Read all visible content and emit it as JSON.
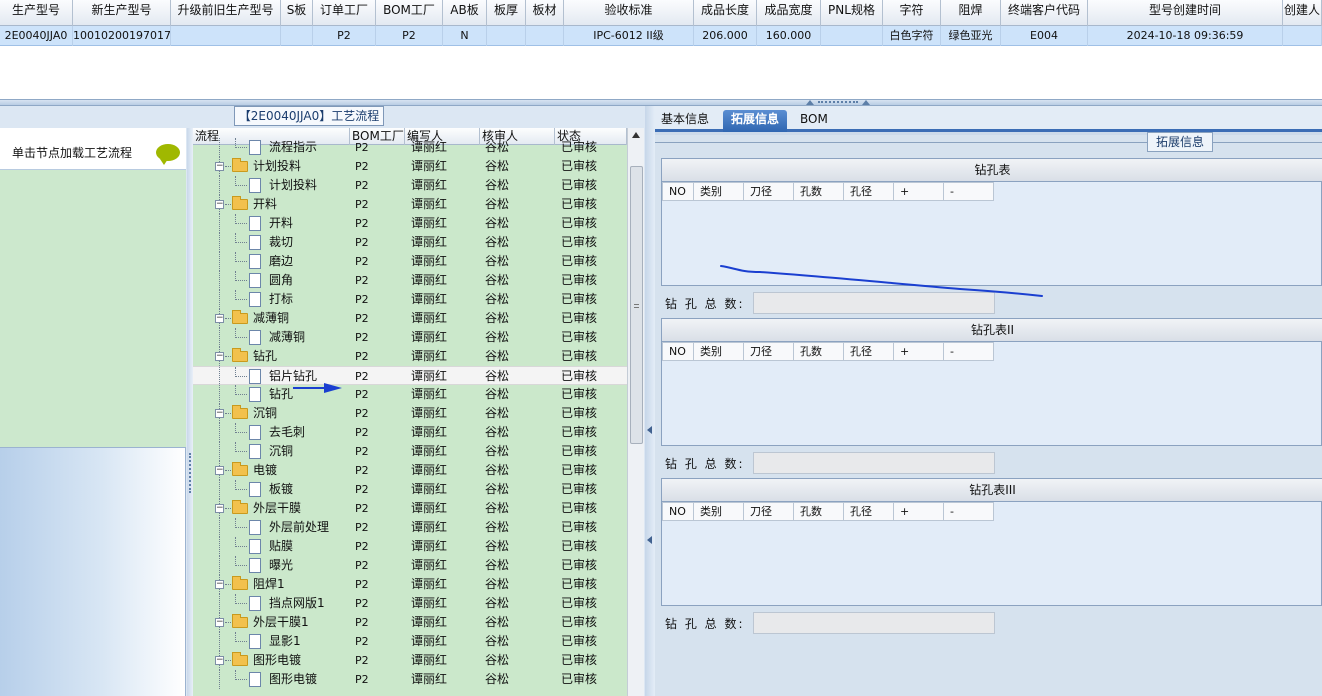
{
  "top_table": {
    "columns": [
      {
        "label": "生产型号",
        "w": 73
      },
      {
        "label": "新生产型号",
        "w": 98
      },
      {
        "label": "升级前旧生产型号",
        "w": 110
      },
      {
        "label": "S板",
        "w": 32
      },
      {
        "label": "订单工厂",
        "w": 63
      },
      {
        "label": "BOM工厂",
        "w": 67
      },
      {
        "label": "AB板",
        "w": 44
      },
      {
        "label": "板厚",
        "w": 39
      },
      {
        "label": "板材",
        "w": 38
      },
      {
        "label": "验收标准",
        "w": 130
      },
      {
        "label": "成品长度",
        "w": 63
      },
      {
        "label": "成品宽度",
        "w": 64
      },
      {
        "label": "PNL规格",
        "w": 62
      },
      {
        "label": "字符",
        "w": 58
      },
      {
        "label": "阻焊",
        "w": 60
      },
      {
        "label": "终端客户代码",
        "w": 87
      },
      {
        "label": "型号创建时间",
        "w": 195
      },
      {
        "label": "创建人",
        "w": 39
      }
    ],
    "row": [
      "2E0040JJA0",
      "10010200197017",
      "",
      "",
      "P2",
      "P2",
      "N",
      "",
      "",
      "IPC-6012 II级",
      "206.000",
      "160.000",
      "",
      "白色字符",
      "绿色亚光",
      "E004",
      "2024-10-18 09:36:59",
      ""
    ]
  },
  "process_title": "【2E0040JJA0】工艺流程",
  "left_panel": {
    "load_text": "单击节点加载工艺流程"
  },
  "tree_columns": [
    "流程",
    "BOM工厂",
    "编写人",
    "核审人",
    "状态"
  ],
  "tree_rows": [
    {
      "lvl": 1,
      "name": "流程指示",
      "bom": "P2",
      "writer": "谭丽红",
      "checker": "谷松",
      "status": "已审核"
    },
    {
      "lvl": 0,
      "name": "计划投料",
      "bom": "P2",
      "writer": "谭丽红",
      "checker": "谷松",
      "status": "已审核"
    },
    {
      "lvl": 1,
      "name": "计划投料",
      "bom": "P2",
      "writer": "谭丽红",
      "checker": "谷松",
      "status": "已审核"
    },
    {
      "lvl": 0,
      "name": "开料",
      "bom": "P2",
      "writer": "谭丽红",
      "checker": "谷松",
      "status": "已审核"
    },
    {
      "lvl": 1,
      "name": "开料",
      "bom": "P2",
      "writer": "谭丽红",
      "checker": "谷松",
      "status": "已审核"
    },
    {
      "lvl": 1,
      "name": "裁切",
      "bom": "P2",
      "writer": "谭丽红",
      "checker": "谷松",
      "status": "已审核"
    },
    {
      "lvl": 1,
      "name": "磨边",
      "bom": "P2",
      "writer": "谭丽红",
      "checker": "谷松",
      "status": "已审核"
    },
    {
      "lvl": 1,
      "name": "圆角",
      "bom": "P2",
      "writer": "谭丽红",
      "checker": "谷松",
      "status": "已审核"
    },
    {
      "lvl": 1,
      "name": "打标",
      "bom": "P2",
      "writer": "谭丽红",
      "checker": "谷松",
      "status": "已审核"
    },
    {
      "lvl": 0,
      "name": "减薄铜",
      "bom": "P2",
      "writer": "谭丽红",
      "checker": "谷松",
      "status": "已审核"
    },
    {
      "lvl": 1,
      "name": "减薄铜",
      "bom": "P2",
      "writer": "谭丽红",
      "checker": "谷松",
      "status": "已审核"
    },
    {
      "lvl": 0,
      "name": "钻孔",
      "bom": "P2",
      "writer": "谭丽红",
      "checker": "谷松",
      "status": "已审核"
    },
    {
      "lvl": 1,
      "name": "铝片钻孔",
      "bom": "P2",
      "writer": "谭丽红",
      "checker": "谷松",
      "status": "已审核",
      "selected": true
    },
    {
      "lvl": 1,
      "name": "钻孔",
      "bom": "P2",
      "writer": "谭丽红",
      "checker": "谷松",
      "status": "已审核"
    },
    {
      "lvl": 0,
      "name": "沉铜",
      "bom": "P2",
      "writer": "谭丽红",
      "checker": "谷松",
      "status": "已审核"
    },
    {
      "lvl": 1,
      "name": "去毛刺",
      "bom": "P2",
      "writer": "谭丽红",
      "checker": "谷松",
      "status": "已审核"
    },
    {
      "lvl": 1,
      "name": "沉铜",
      "bom": "P2",
      "writer": "谭丽红",
      "checker": "谷松",
      "status": "已审核"
    },
    {
      "lvl": 0,
      "name": "电镀",
      "bom": "P2",
      "writer": "谭丽红",
      "checker": "谷松",
      "status": "已审核"
    },
    {
      "lvl": 1,
      "name": "板镀",
      "bom": "P2",
      "writer": "谭丽红",
      "checker": "谷松",
      "status": "已审核"
    },
    {
      "lvl": 0,
      "name": "外层干膜",
      "bom": "P2",
      "writer": "谭丽红",
      "checker": "谷松",
      "status": "已审核"
    },
    {
      "lvl": 1,
      "name": "外层前处理",
      "bom": "P2",
      "writer": "谭丽红",
      "checker": "谷松",
      "status": "已审核"
    },
    {
      "lvl": 1,
      "name": "贴膜",
      "bom": "P2",
      "writer": "谭丽红",
      "checker": "谷松",
      "status": "已审核"
    },
    {
      "lvl": 1,
      "name": "曝光",
      "bom": "P2",
      "writer": "谭丽红",
      "checker": "谷松",
      "status": "已审核"
    },
    {
      "lvl": 0,
      "name": "阻焊1",
      "bom": "P2",
      "writer": "谭丽红",
      "checker": "谷松",
      "status": "已审核"
    },
    {
      "lvl": 1,
      "name": "挡点网版1",
      "bom": "P2",
      "writer": "谭丽红",
      "checker": "谷松",
      "status": "已审核"
    },
    {
      "lvl": 0,
      "name": "外层干膜1",
      "bom": "P2",
      "writer": "谭丽红",
      "checker": "谷松",
      "status": "已审核"
    },
    {
      "lvl": 1,
      "name": "显影1",
      "bom": "P2",
      "writer": "谭丽红",
      "checker": "谷松",
      "status": "已审核"
    },
    {
      "lvl": 0,
      "name": "图形电镀",
      "bom": "P2",
      "writer": "谭丽红",
      "checker": "谷松",
      "status": "已审核"
    },
    {
      "lvl": 1,
      "name": "图形电镀",
      "bom": "P2",
      "writer": "谭丽红",
      "checker": "谷松",
      "status": "已审核"
    }
  ],
  "right_tabs": [
    "基本信息",
    "拓展信息",
    "BOM"
  ],
  "active_tab": 1,
  "ext_title": "拓展信息",
  "drill_tables": [
    {
      "title": "钻孔表",
      "total_label": "钻 孔 总 数:"
    },
    {
      "title": "钻孔表II",
      "total_label": "钻 孔 总 数:"
    },
    {
      "title": "钻孔表III",
      "total_label": "钻 孔 总 数:"
    }
  ],
  "drill_columns": [
    "NO",
    "类别",
    "刀径",
    "孔数",
    "孔径",
    "+",
    "-"
  ],
  "annotation_colors": {
    "blue_line": "#1a3fd0",
    "arrow": "#1a3fd0"
  }
}
